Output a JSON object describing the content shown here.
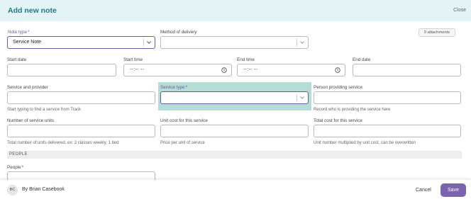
{
  "header": {
    "title": "Add new note",
    "close_label": "Close"
  },
  "attachments_label": "0 attachments",
  "fields": {
    "note_type": {
      "label": "Note type",
      "value": "Service Note"
    },
    "method_of_delivery": {
      "label": "Method of delivery",
      "value": ""
    },
    "start_date": {
      "label": "Start date",
      "value": ""
    },
    "start_time": {
      "label": "Start time",
      "value": "--:-- --"
    },
    "end_time": {
      "label": "End time",
      "value": "--:-- --"
    },
    "end_date": {
      "label": "End date",
      "value": ""
    },
    "service_and_provider": {
      "label": "Service and provider",
      "value": "",
      "help": "Start typing to find a service from Track"
    },
    "service_type": {
      "label": "Service type",
      "value": ""
    },
    "person_providing_service": {
      "label": "Person providing service",
      "value": "",
      "help": "Record who is providing the service here"
    },
    "number_of_service_units": {
      "label": "Number of service units",
      "value": "",
      "help": "Total number of units delivered. ex: 2 classes weekly, 1 bed"
    },
    "unit_cost": {
      "label": "Unit cost for this service",
      "value": "",
      "help": "Price per unit of service"
    },
    "total_cost": {
      "label": "Total cost for this service",
      "value": "",
      "help": "Unit number multiplied by unit cost, can be overwritten"
    },
    "people": {
      "label": "People",
      "value": ""
    }
  },
  "section_people": "PEOPLE",
  "footer": {
    "avatar_initials": "BC",
    "byline": "By Brian Casebook",
    "cancel_label": "Cancel",
    "save_label": "Save"
  },
  "colors": {
    "accent": "#6d5aa7",
    "title": "#1f7a8c",
    "header_bg": "#e4f3f6",
    "highlight": "#b5dcd5",
    "save_bg": "#7a64b0"
  },
  "icons": {
    "dropdown": "chevron-down-icon",
    "time": "clock-icon"
  }
}
